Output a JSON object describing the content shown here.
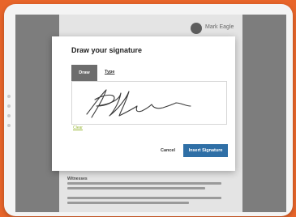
{
  "modal": {
    "title": "Draw your signature",
    "tabs": [
      {
        "label": "Draw",
        "active": true
      },
      {
        "label": "Type",
        "active": false
      }
    ],
    "clear_label": "Clear",
    "cancel_label": "Cancel",
    "insert_label": "Insert Signature"
  },
  "background_doc": {
    "user_name": "Mark Eagle",
    "section_heading": "Witnesses"
  },
  "colors": {
    "frame_orange": "#e8652a",
    "primary_button": "#2f6fa6",
    "clear_link": "#9ab83a"
  }
}
